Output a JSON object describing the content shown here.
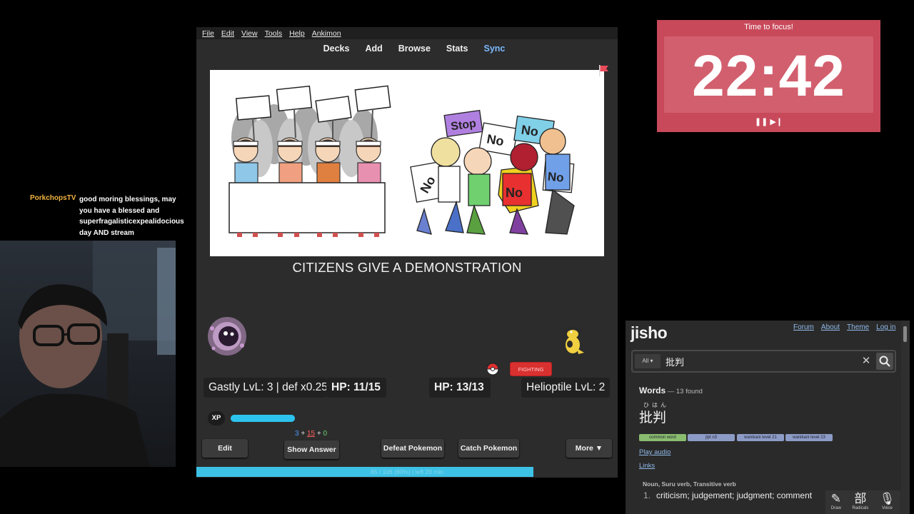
{
  "anki": {
    "menu": [
      "File",
      "Edit",
      "View",
      "Tools",
      "Help",
      "Ankimon"
    ],
    "toolbar": [
      "Decks",
      "Add",
      "Browse",
      "Stats",
      "Sync"
    ],
    "card": {
      "caption": "CITIZENS GIVE A DEMONSTRATION",
      "sign_text": {
        "stop": "Stop",
        "no": "No"
      }
    },
    "battle": {
      "player_level": "Gastly LvL: 3 | def x0.25",
      "player_hp": "HP: 11/15",
      "enemy_hp": "HP: 13/13",
      "enemy_level": "Helioptile LvL: 2",
      "type_badge": "FIGHTING",
      "xp_label": "XP",
      "xp_progress": 1.0
    },
    "counts": {
      "new": "3",
      "sep1": " + ",
      "learn": "15",
      "sep2": " + ",
      "review": "0"
    },
    "buttons": {
      "edit": "Edit",
      "show_answer": "Show Answer",
      "defeat": "Defeat Pokemon",
      "catch": "Catch Pokemon",
      "more": "More ▼"
    },
    "progress": {
      "text": "85 / 106 (80%) | left 20 min",
      "fraction": 0.8
    }
  },
  "timer": {
    "title": "Time to focus!",
    "time": "22:42",
    "controls": "❚❚ ▶❙"
  },
  "chat": {
    "user": "PorkchopsTV",
    "message": "good moring blessings, may you have a blessed and superfragalisticexpealidocious day AND stream"
  },
  "jisho": {
    "logo": "jisho",
    "nav": [
      "Forum",
      "About",
      "Theme",
      "Log in"
    ],
    "search": {
      "scope": "All ▾",
      "query": "批判"
    },
    "words_label": "Words",
    "found": " — 13 found",
    "furigana": "ひはん",
    "word": "批判",
    "tags": [
      "common word",
      "jlpt n3",
      "wanikani level 21",
      "wanikani level 23"
    ],
    "play_audio": "Play audio",
    "links": "Links",
    "pos": "Noun, Suru verb, Transitive verb",
    "meaning_num": "1.",
    "meaning": "criticism; judgement; judgment; comment",
    "tools": [
      {
        "glyph": "✎",
        "label": "Draw"
      },
      {
        "glyph": "部",
        "label": "Radicals"
      },
      {
        "glyph": "🎙",
        "label": "Voice"
      }
    ]
  },
  "colors": {
    "timer_bg": "#c8495a",
    "xp_bar": "#2cc4ee",
    "progress_bar": "#3dc2e6",
    "fighting_badge": "#d93030",
    "chat_username": "#f3b341"
  }
}
